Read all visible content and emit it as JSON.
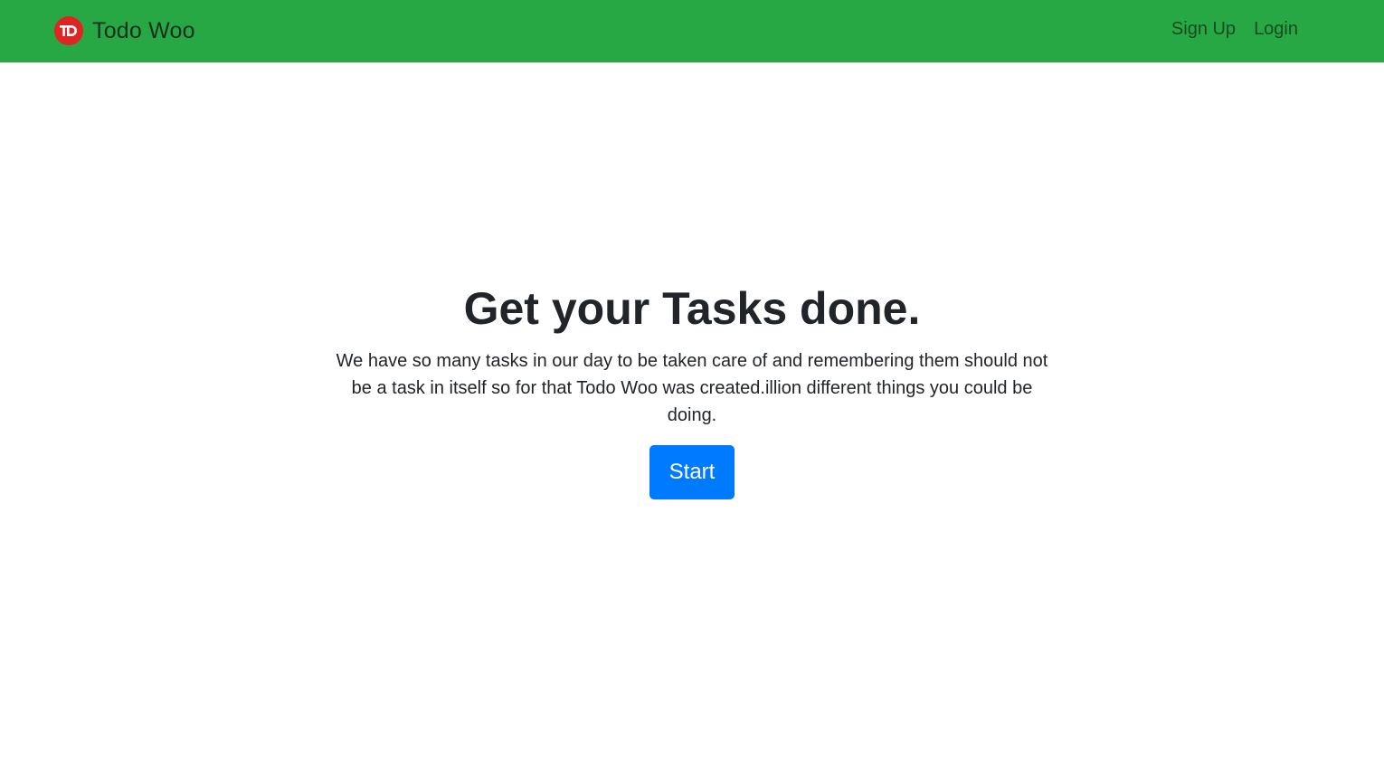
{
  "navbar": {
    "brand_name": "Todo Woo",
    "brand_logo_text": "TD",
    "bg_color": "#28a745",
    "links": [
      {
        "label": "Sign Up"
      },
      {
        "label": "Login"
      }
    ]
  },
  "hero": {
    "title": "Get your Tasks done.",
    "text": "We have so many tasks in our day to be taken care of and remembering them should not be a task in itself so for that Todo Woo was created.illion different things you could be doing.",
    "button_label": "Start",
    "button_color": "#007bff"
  }
}
